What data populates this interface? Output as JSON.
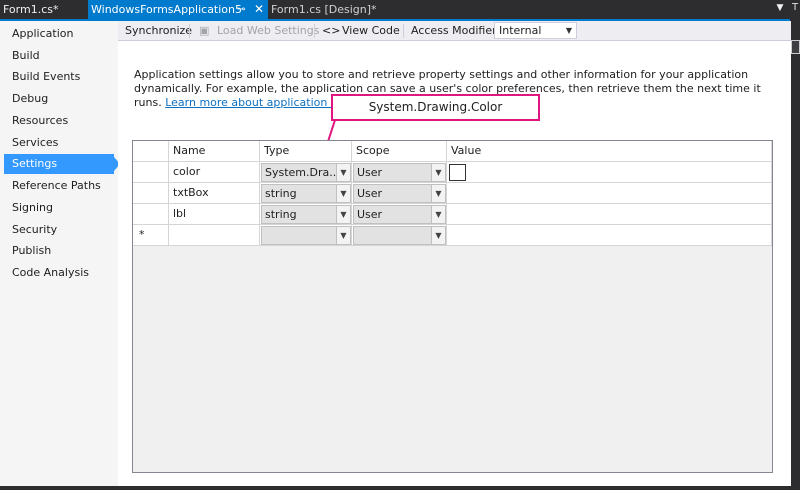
{
  "tabs": [
    {
      "label": "Form1.cs*"
    },
    {
      "label": "WindowsFormsApplication5",
      "pin": "⊸",
      "close": "✕"
    },
    {
      "label": "Form1.cs [Design]*"
    }
  ],
  "right_strip_letter": "T",
  "nav": {
    "items": [
      {
        "label": "Application"
      },
      {
        "label": "Build"
      },
      {
        "label": "Build Events"
      },
      {
        "label": "Debug"
      },
      {
        "label": "Resources"
      },
      {
        "label": "Services"
      },
      {
        "label": "Settings",
        "selected": true
      },
      {
        "label": "Reference Paths"
      },
      {
        "label": "Signing"
      },
      {
        "label": "Security"
      },
      {
        "label": "Publish"
      },
      {
        "label": "Code Analysis"
      }
    ]
  },
  "toolbar": {
    "synchronize": "Synchronize",
    "load_web_settings": "Load Web Settings",
    "view_code": "View Code",
    "access_modifier_label": "Access Modifier:",
    "access_modifier_value": "Internal"
  },
  "description": {
    "text": "Application settings allow you to store and retrieve property settings and other information for your application dynamically. For example, the application can save a user's color preferences, then retrieve them the next time it runs.",
    "link": "Learn more about application settings..."
  },
  "callout": {
    "text": "System.Drawing.Color",
    "color": "#e0157f"
  },
  "grid": {
    "headers": {
      "name": "Name",
      "type": "Type",
      "scope": "Scope",
      "value": "Value"
    },
    "rows": [
      {
        "name": "color",
        "type": "System.Dra...",
        "scope": "User",
        "value": ""
      },
      {
        "name": "txtBox",
        "type": "string",
        "scope": "User",
        "value": ""
      },
      {
        "name": "lbl",
        "type": "string",
        "scope": "User",
        "value": ""
      }
    ],
    "new_row_marker": "*"
  },
  "colors": {
    "accent": "#007acc",
    "selected_nav": "#3399ff",
    "link": "#0e70c0"
  }
}
